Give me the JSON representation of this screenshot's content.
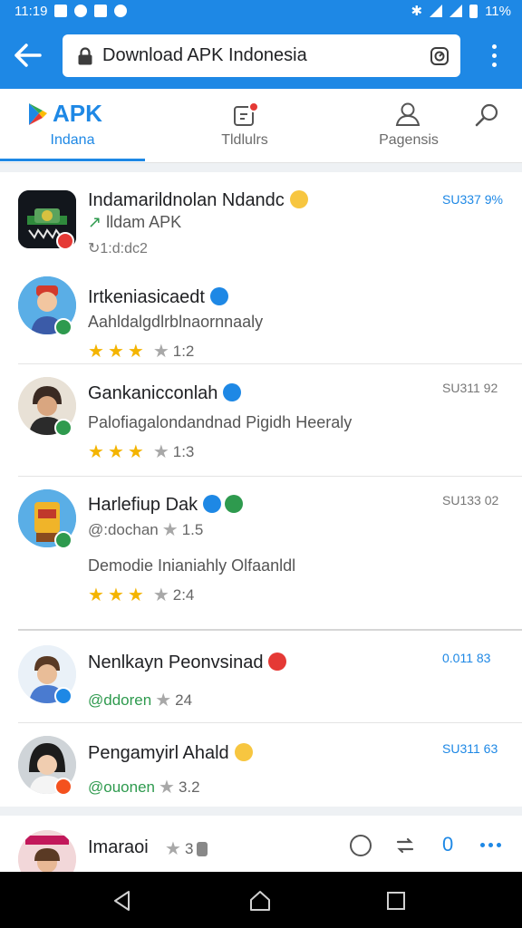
{
  "status_bar": {
    "time": "11:19",
    "battery": "11%"
  },
  "address_bar": {
    "url_text": "Download APK Indonesia"
  },
  "tabs": [
    {
      "label": "Indana",
      "logo_text": "APK"
    },
    {
      "label": "Tldlulrs"
    },
    {
      "label": "Pagensis"
    }
  ],
  "items": [
    {
      "title": "Indamarildnolan Ndandc",
      "sub": "lldam APK",
      "extra": "↻1:d:dc2",
      "meta": "SU337 9%"
    },
    {
      "title": "Irtkeniasicaedt",
      "sub": "Aahldalgdlrblnaornnaaly",
      "rating": "1:2",
      "meta": ""
    },
    {
      "title": "Gankanicconlah",
      "sub": "Palofiagalondandnad Pigidh Heeraly",
      "rating": "1:3",
      "meta": "SU311 92"
    },
    {
      "title": "Harlefiup Dak",
      "sub": "@:dochan",
      "sub_rating": "1.5",
      "desc": "Demodie Inianiahly Olfaanldl",
      "rating": "2:4",
      "meta": "SU133 02"
    },
    {
      "title": "Nenlkayn Peonvsinad",
      "sub": "@ddoren",
      "sub_rating": "24",
      "meta": "0.011 83"
    },
    {
      "title": "Pengamyirl Ahald",
      "sub": "@ouonen",
      "sub_rating": "3.2",
      "meta": "SU311 63"
    },
    {
      "title": "Imaraoi",
      "sub_rating": "3"
    }
  ],
  "bottom_actions": {
    "count": "0"
  },
  "colors": {
    "accent": "#1e88e5",
    "star": "#f4b400",
    "verified_green": "#2e9a4e",
    "alert_red": "#e53935"
  }
}
